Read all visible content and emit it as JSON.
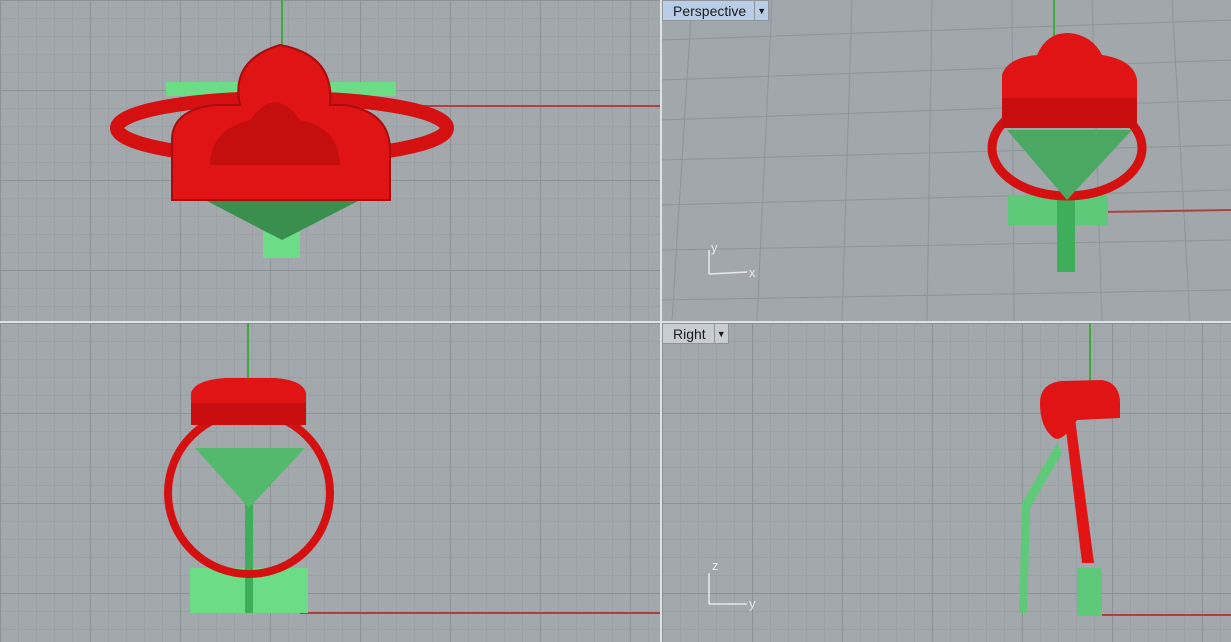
{
  "viewports": {
    "top": {
      "label": ""
    },
    "perspective": {
      "label": "Perspective"
    },
    "front": {
      "label": ""
    },
    "right": {
      "label": "Right"
    }
  },
  "axes": {
    "perspective": {
      "a": "y",
      "b": "x"
    },
    "right": {
      "a": "z",
      "b": "y"
    }
  },
  "colors": {
    "model": "#e01414",
    "supports": "#5fc97a",
    "grid": "#a3a8ad",
    "x_axis": "#b04040",
    "y_axis": "#3daa3d"
  },
  "icons": {
    "dropdown": "triangle-down"
  }
}
